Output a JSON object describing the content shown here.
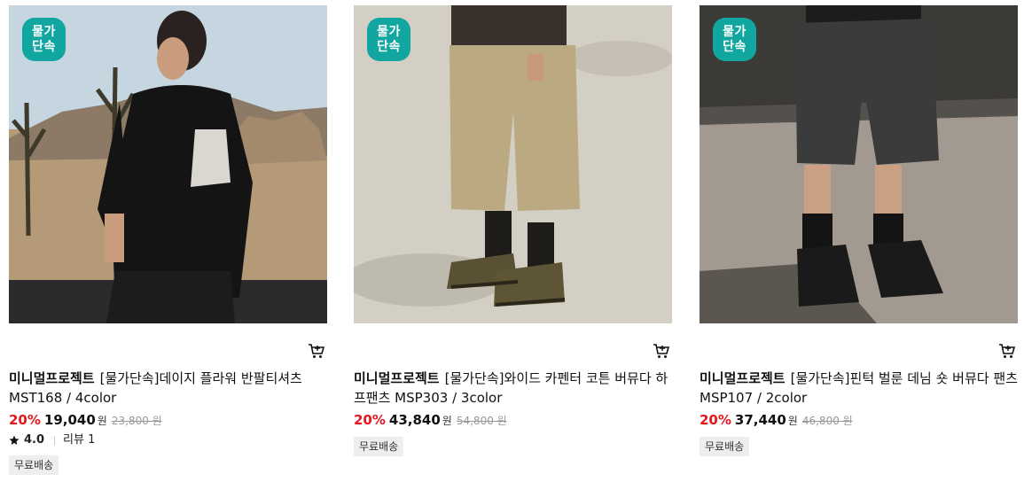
{
  "products": [
    {
      "badge": [
        "물가",
        "단속"
      ],
      "brand": "미니멀프로젝트",
      "name": "[물가단속]데이지 플라워 반팔티셔츠 MST168 / 4color",
      "discount": "20%",
      "price": "19,040",
      "won": "원",
      "original_price": "23,800 원",
      "rating": "4.0",
      "review_label": "리뷰 1",
      "shipping": "무료배송",
      "image_colors": {
        "sky": "#bfd3e0",
        "ground": "#a88c6c",
        "shirt": "#161616"
      }
    },
    {
      "badge": [
        "물가",
        "단속"
      ],
      "brand": "미니멀프로젝트",
      "name": "[물가단속]와이드 카펜터 코튼 버뮤다 하프팬츠 MSP303 / 3color",
      "discount": "20%",
      "price": "43,840",
      "won": "원",
      "original_price": "54,800 원",
      "shipping": "무료배송",
      "image_colors": {
        "ground": "#cfcabd",
        "pants": "#b9a887",
        "sock": "#1e1e1a"
      }
    },
    {
      "badge": [
        "물가",
        "단속"
      ],
      "brand": "미니멀프로젝트",
      "name": "[물가단속]핀턱 벌룬 데님 숏 버뮤다 팬츠 MSP107 / 2color",
      "discount": "20%",
      "price": "37,440",
      "won": "원",
      "original_price": "46,800 원",
      "shipping": "무료배송",
      "image_colors": {
        "ground": "#a49c92",
        "pants": "#3a3a3a",
        "wall": "#3d3b38"
      }
    }
  ],
  "icons": {
    "cart": "cart-icon",
    "star": "star-icon"
  },
  "accent": {
    "badge": "#12a6a0",
    "discount": "#e5161c"
  }
}
